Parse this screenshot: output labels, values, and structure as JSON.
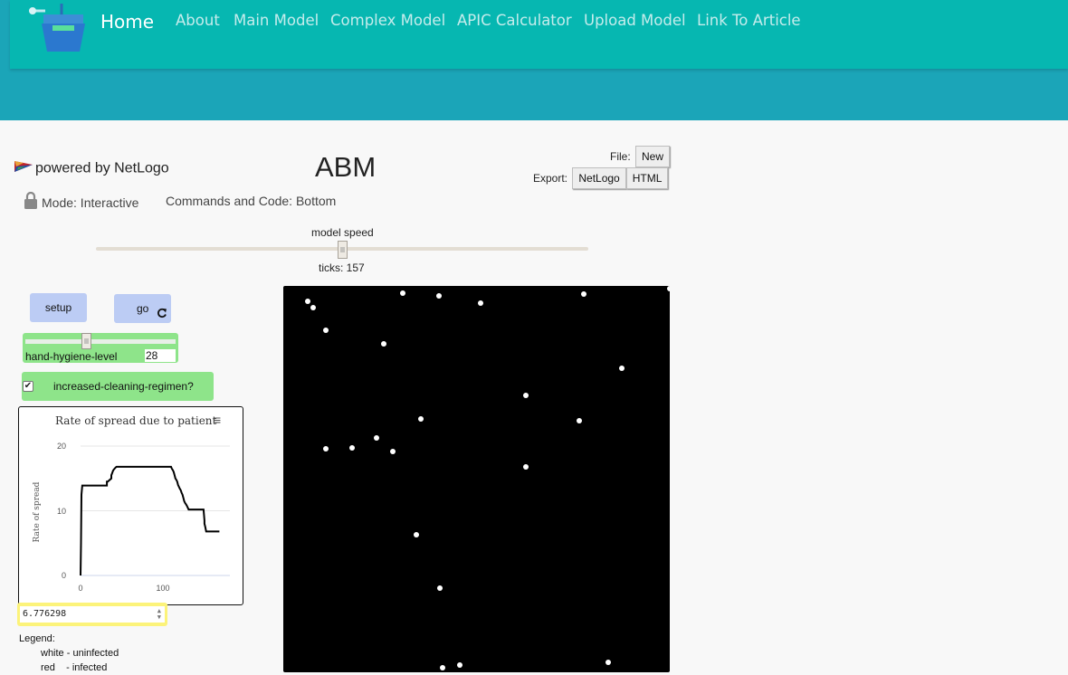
{
  "nav": {
    "items": [
      "Home",
      "About",
      "Main Model",
      "Complex Model",
      "APIC Calculator",
      "Upload Model",
      "Link To Article"
    ]
  },
  "brand": {
    "label": "powered by NetLogo"
  },
  "model": {
    "name": "ABM"
  },
  "file": {
    "label": "File:",
    "new_button": "New"
  },
  "export": {
    "label": "Export:",
    "netlogo_button": "NetLogo",
    "html_button": "HTML"
  },
  "mode": {
    "label": "Mode: Interactive"
  },
  "commands": {
    "label": "Commands and Code: Bottom"
  },
  "speed": {
    "label": "model speed",
    "value_fraction": 0.5
  },
  "ticks": {
    "label": "ticks: 157"
  },
  "buttons": {
    "setup": "setup",
    "go": "go"
  },
  "slider": {
    "name": "hand-hygiene-level",
    "value": "28"
  },
  "switch": {
    "label": "increased-cleaning-regimen?",
    "checked": true
  },
  "plot": {
    "title": "Rate of spread due to patient",
    "ylabel": "Rate of spread",
    "xticks": [
      "0",
      "100"
    ],
    "yticks": [
      "0",
      "10",
      "20"
    ]
  },
  "chart_data": {
    "type": "line",
    "title": "Rate of spread due to patient",
    "xlabel": "",
    "ylabel": "Rate of spread",
    "xlim": [
      0,
      170
    ],
    "ylim": [
      0,
      20
    ],
    "grid": true,
    "series": [
      {
        "color": "#000000",
        "x": [
          0,
          0.5,
          1,
          2,
          30,
          30,
          31,
          35,
          35,
          36,
          37,
          38,
          40,
          41,
          103,
          104,
          105,
          106,
          107,
          108,
          109,
          110,
          111,
          112,
          113,
          114,
          115,
          116,
          117,
          118,
          119,
          120,
          121,
          122,
          123,
          124,
          125,
          126,
          127,
          140,
          141,
          141,
          142,
          143,
          145,
          158
        ],
        "y": [
          0,
          5,
          12.5,
          13.9,
          13.9,
          14.5,
          14.5,
          15,
          15.5,
          15.8,
          16.2,
          16.4,
          16.7,
          16.8,
          16.8,
          16.5,
          16.3,
          16.0,
          15.5,
          15.0,
          14.8,
          14.5,
          14.0,
          13.7,
          13.4,
          13.2,
          12.8,
          12.5,
          12.0,
          11.5,
          11.2,
          11.0,
          10.8,
          10.5,
          10.2,
          10.2,
          10.2,
          10.2,
          10.2,
          10.2,
          8.5,
          8.0,
          7.5,
          6.8,
          6.8,
          6.8
        ]
      }
    ]
  },
  "monitor": {
    "value": "6.776298"
  },
  "legend": {
    "title": "Legend:",
    "items": [
      "white - uninfected",
      "red    - infected"
    ]
  },
  "world": {
    "background": "#000000",
    "agent_color": "#ffffff",
    "xlim": [
      -16,
      16
    ],
    "ylim": [
      -16,
      16
    ],
    "agents": [
      [
        -13.5,
        14.2
      ],
      [
        -14.0,
        14.7
      ],
      [
        -12.5,
        12.3
      ],
      [
        -7.7,
        11.2
      ],
      [
        -6.1,
        15.4
      ],
      [
        -3.1,
        15.2
      ],
      [
        0.3,
        14.6
      ],
      [
        8.9,
        15.3
      ],
      [
        12.0,
        9.2
      ],
      [
        4.1,
        6.9
      ],
      [
        8.5,
        4.8
      ],
      [
        -4.6,
        5.0
      ],
      [
        -8.3,
        3.4
      ],
      [
        -10.3,
        2.6
      ],
      [
        -12.5,
        2.5
      ],
      [
        -6.9,
        2.3
      ],
      [
        4.1,
        1.0
      ],
      [
        -5.0,
        -4.6
      ],
      [
        -3.0,
        -9.0
      ],
      [
        -2.8,
        -15.6
      ],
      [
        -1.4,
        -15.4
      ],
      [
        10.9,
        -15.2
      ],
      [
        16.0,
        15.8
      ]
    ]
  },
  "colors": {
    "nav_bar": "#06b7b1",
    "header_band": "#1ba5b8",
    "button_blue": "#bcccf4",
    "widget_green": "#8ee48a",
    "monitor_yellow": "#fcf37a"
  }
}
